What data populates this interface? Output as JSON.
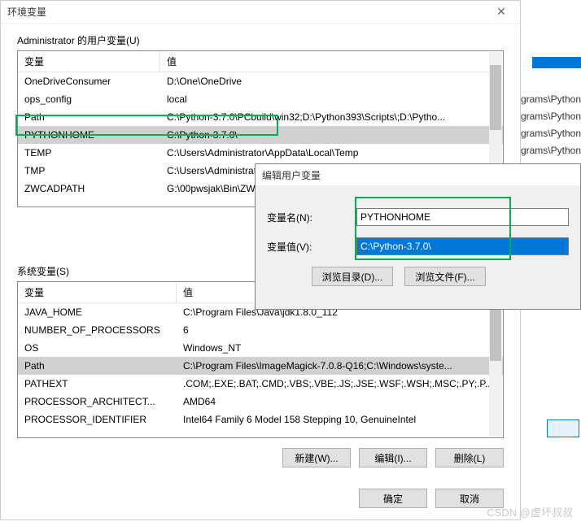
{
  "bg": {
    "lines": [
      "Programs\\Python",
      "Programs\\Python",
      "Programs\\Python",
      "Programs\\Python"
    ]
  },
  "main": {
    "title": "环境变量",
    "userSection": "Administrator 的用户变量(U)",
    "sysSection": "系统变量(S)",
    "headers": {
      "var": "变量",
      "val": "值"
    },
    "userVars": [
      {
        "name": "OneDriveConsumer",
        "val": "D:\\One\\OneDrive"
      },
      {
        "name": "ops_config",
        "val": "local"
      },
      {
        "name": "Path",
        "val": "C:\\Python-3.7.0\\PCbuild\\win32;D:\\Python393\\Scripts\\;D:\\Pytho..."
      },
      {
        "name": "PYTHONHOME",
        "val": "C:\\Python-3.7.0\\"
      },
      {
        "name": "TEMP",
        "val": "C:\\Users\\Administrator\\AppData\\Local\\Temp"
      },
      {
        "name": "TMP",
        "val": "C:\\Users\\Administrator"
      },
      {
        "name": "ZWCADPATH",
        "val": "G:\\00pwsjak\\Bin\\ZW"
      }
    ],
    "sysVars": [
      {
        "name": "JAVA_HOME",
        "val": "C:\\Program Files\\Java\\jdk1.8.0_112"
      },
      {
        "name": "NUMBER_OF_PROCESSORS",
        "val": "6"
      },
      {
        "name": "OS",
        "val": "Windows_NT"
      },
      {
        "name": "Path",
        "val": "C:\\Program Files\\ImageMagick-7.0.8-Q16;C:\\Windows\\syste..."
      },
      {
        "name": "PATHEXT",
        "val": ".COM;.EXE;.BAT;.CMD;.VBS;.VBE;.JS;.JSE;.WSF;.WSH;.MSC;.PY;.P..."
      },
      {
        "name": "PROCESSOR_ARCHITECT...",
        "val": "AMD64"
      },
      {
        "name": "PROCESSOR_IDENTIFIER",
        "val": "Intel64 Family 6 Model 158 Stepping 10, GenuineIntel"
      }
    ],
    "buttons": {
      "new": "新建(W)...",
      "edit": "编辑(I)...",
      "del": "删除(L)",
      "ok": "确定",
      "cancel": "取消"
    }
  },
  "edit": {
    "title": "编辑用户变量",
    "nameLabel": "变量名(N):",
    "valLabel": "变量值(V):",
    "nameVal": "PYTHONHOME",
    "valVal": "C:\\Python-3.7.0\\",
    "browseDir": "浏览目录(D)...",
    "browseFile": "浏览文件(F)..."
  },
  "watermark": "CSDN @虚坏叔叔"
}
